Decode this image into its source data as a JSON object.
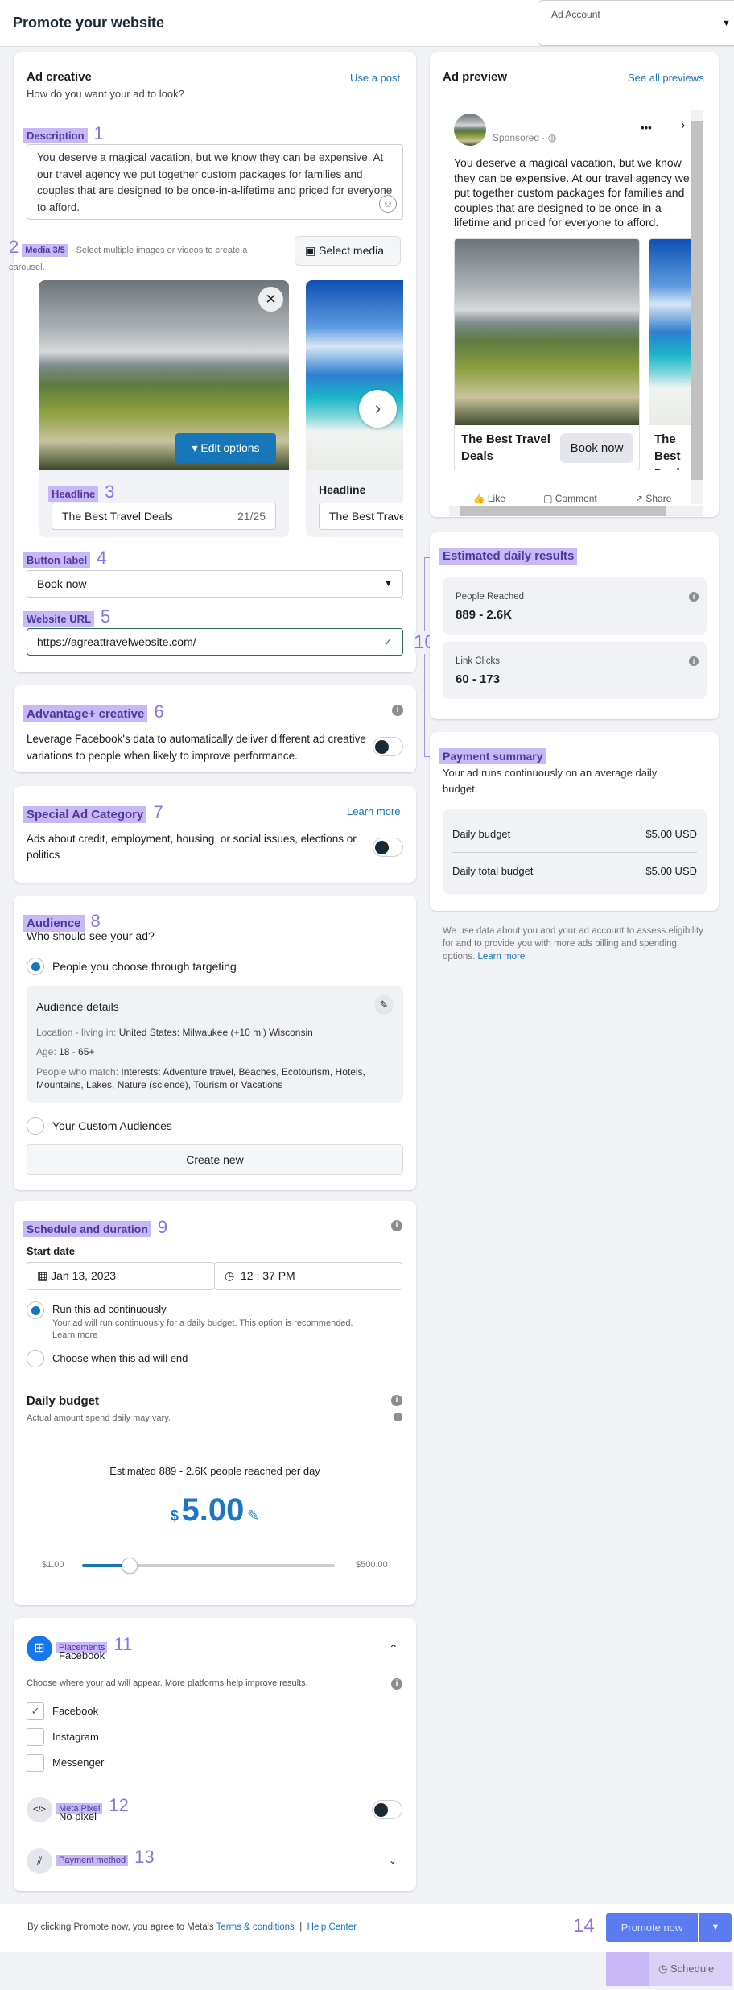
{
  "header": {
    "title": "Promote your website",
    "ad_account_label": "Ad Account"
  },
  "ad_creative": {
    "title": "Ad creative",
    "subtitle": "How do you want your ad to look?",
    "use_post": "Use a post",
    "description_label": "Description",
    "description_num": "1",
    "description": "You deserve a magical vacation, but we know they can be expensive. At our travel agency we put together custom packages for families and couples that are designed to be once-in-a-lifetime and priced for everyone to afford.",
    "media_label": "Media 3/5",
    "media_num": "2",
    "media_hint": "· Select multiple images or videos to create a carousel.",
    "select_media": "Select media",
    "edit_options": "Edit options",
    "headline_label": "Headline",
    "headline_num": "3",
    "headline_value": "The Best Travel Deals",
    "headline_count": "21/25",
    "headline2_label": "Headline",
    "headline2_value": "The Best Travel",
    "button_label": "Button label",
    "button_num": "4",
    "button_value": "Book now",
    "url_label": "Website URL",
    "url_num": "5",
    "url_value": "https://agreattravelwebsite.com/"
  },
  "advantage": {
    "title": "Advantage+ creative",
    "num": "6",
    "text": "Leverage Facebook's data to automatically deliver different ad creative variations to people when likely to improve performance.",
    "enabled": false
  },
  "special": {
    "title": "Special Ad Category",
    "num": "7",
    "learn_more": "Learn more",
    "text": "Ads about credit, employment, housing, or social issues, elections or politics",
    "enabled": false
  },
  "audience": {
    "title": "Audience",
    "num": "8",
    "subtitle": "Who should see your ad?",
    "option1": "People you choose through targeting",
    "details_title": "Audience details",
    "location_label": "Location - living in: ",
    "location": "United States: Milwaukee (+10 mi) Wisconsin",
    "age_label": "Age: ",
    "age": "18 - 65+",
    "match_label": "People who match: ",
    "match": "Interests: Adventure travel, Beaches, Ecotourism, Hotels, Mountains, Lakes, Nature (science), Tourism or Vacations",
    "option2": "Your Custom Audiences",
    "create_new": "Create new"
  },
  "schedule": {
    "title": "Schedule and duration",
    "num": "9",
    "start_date_label": "Start date",
    "date": "Jan 13, 2023",
    "time": "12 : 37 PM",
    "run_continuous": "Run this ad continuously",
    "run_continuous_hint": "Your ad will run continuously for a daily budget. This option is recommended.",
    "learn_more": "Learn more",
    "choose_end": "Choose when this ad will end",
    "budget_title": "Daily budget",
    "budget_hint": "Actual amount spend daily may vary.",
    "estimate": "Estimated 889 - 2.6K people reached per day",
    "currency": "$",
    "amount": "5.00",
    "min": "$1.00",
    "max": "$500.00",
    "slider_value": 5
  },
  "placements": {
    "title": "Placements",
    "num": "11",
    "value": "Facebook",
    "hint": "Choose where your ad will appear. More platforms help improve results.",
    "options": [
      {
        "label": "Facebook",
        "checked": true
      },
      {
        "label": "Instagram",
        "checked": false
      },
      {
        "label": "Messenger",
        "checked": false
      }
    ],
    "pixel_title": "Meta Pixel",
    "pixel_num": "12",
    "pixel_value": "No pixel",
    "payment_title": "Payment method",
    "payment_num": "13"
  },
  "preview": {
    "title": "Ad preview",
    "see_all": "See all previews",
    "sponsored": "Sponsored · ",
    "text": "You deserve a magical vacation, but we know they can be expensive. At our travel agency we put together custom packages for families and couples that are designed to be once-in-a-lifetime and priced for everyone to afford.",
    "card1_title": "The Best Travel Deals",
    "card_button": "Book now",
    "card2_title": "The Best Deals",
    "like": "Like",
    "comment": "Comment",
    "share": "Share"
  },
  "estimated": {
    "title": "Estimated daily results",
    "num": "10",
    "reached_label": "People Reached",
    "reached": "889 - 2.6K",
    "clicks_label": "Link Clicks",
    "clicks": "60 - 173"
  },
  "payment": {
    "title": "Payment summary",
    "text": "Your ad runs continuously on an average daily budget.",
    "daily_label": "Daily budget",
    "daily": "$5.00 USD",
    "total_label": "Daily total budget",
    "total": "$5.00 USD"
  },
  "note": {
    "text": "We use data about you and your ad account to assess eligibility for and to provide you with more ads billing and spending options. ",
    "learn_more": "Learn more"
  },
  "footer": {
    "text": "By clicking Promote now, you agree to Meta's ",
    "terms": "Terms & conditions",
    "sep": "|",
    "help": "Help Center",
    "num": "14",
    "promote": "Promote now",
    "schedule": "Schedule"
  },
  "colors": {
    "accent": "#1877b9",
    "promote": "#5b7cf0",
    "highlight": "#c9b8f7"
  }
}
